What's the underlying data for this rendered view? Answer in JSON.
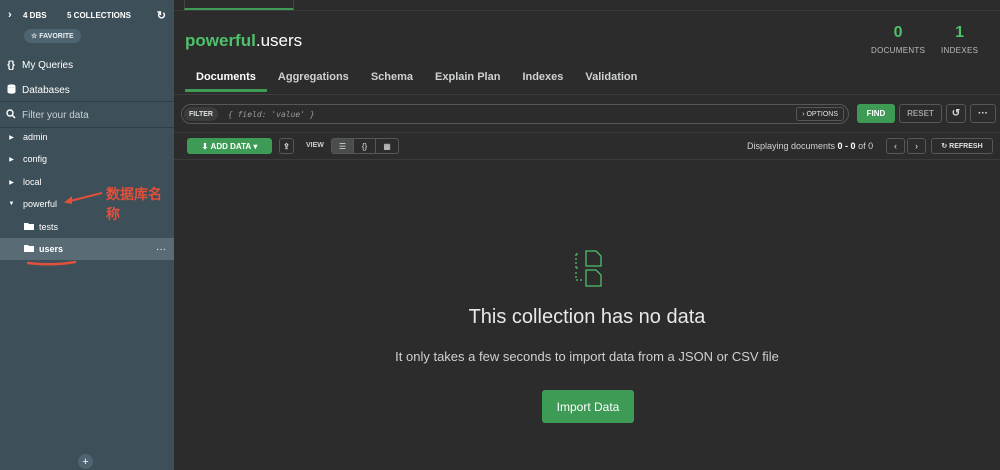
{
  "sidebar": {
    "db_count": "4 DBS",
    "collection_count": "5 COLLECTIONS",
    "favorite": "☆ FAVORITE",
    "my_queries": "My Queries",
    "databases": "Databases",
    "filter_placeholder": "Filter your data",
    "tree": [
      {
        "label": "admin",
        "expanded": false
      },
      {
        "label": "config",
        "expanded": false
      },
      {
        "label": "local",
        "expanded": false
      },
      {
        "label": "powerful",
        "expanded": true
      }
    ],
    "collections": [
      {
        "label": "tests"
      },
      {
        "label": "users",
        "selected": true
      }
    ],
    "annotation": "数据库名称"
  },
  "header": {
    "database": "powerful",
    "collection": ".users",
    "documents_count": "0",
    "documents_label": "DOCUMENTS",
    "indexes_count": "1",
    "indexes_label": "INDEXES"
  },
  "tabs": [
    "Documents",
    "Aggregations",
    "Schema",
    "Explain Plan",
    "Indexes",
    "Validation"
  ],
  "filter": {
    "pill": "FILTER",
    "placeholder": "{ field: 'value' }",
    "options": "OPTIONS",
    "find": "FIND",
    "reset": "RESET"
  },
  "toolbar": {
    "add_data": "ADD DATA",
    "view_label": "VIEW",
    "display_prefix": "Displaying documents ",
    "display_range": "0 - 0",
    "display_suffix": " of 0",
    "refresh": "REFRESH"
  },
  "empty_state": {
    "title": "This collection has no data",
    "subtitle": "It only takes a few seconds to import data from a JSON or CSV file",
    "button": "Import Data"
  },
  "colors": {
    "accent": "#3d9b55",
    "accent_text": "#4fc06b",
    "sidebar_bg": "#3d4f58",
    "annotation": "#e0503a"
  }
}
